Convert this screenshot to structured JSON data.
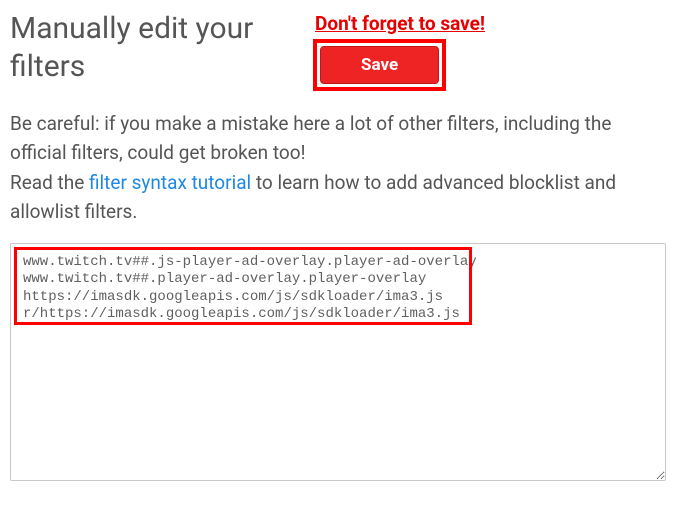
{
  "header": {
    "title": "Manually edit your filters",
    "reminder": "Don't forget to save!",
    "save_label": "Save"
  },
  "description": {
    "warning": "Be careful: if you make a mistake here a lot of other filters, including the official filters, could get broken too!",
    "read_prefix": "Read the ",
    "tutorial_link": "filter syntax tutorial",
    "read_suffix": " to learn how to add advanced blocklist and allowlist filters."
  },
  "filters": {
    "content": "www.twitch.tv##.js-player-ad-overlay.player-ad-overlay\nwww.twitch.tv##.player-ad-overlay.player-overlay\nhttps://imasdk.googleapis.com/js/sdkloader/ima3.js\nr/https://imasdk.googleapis.com/js/sdkloader/ima3.js"
  },
  "colors": {
    "accent_red": "#ee2424",
    "highlight_red": "#ff0000",
    "link_blue": "#1e88e5",
    "text_gray": "#555555"
  }
}
